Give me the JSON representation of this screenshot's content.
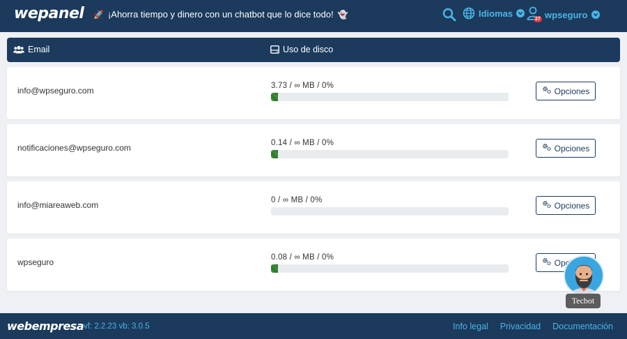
{
  "app": {
    "logo": "wepanel"
  },
  "header": {
    "promo_text": "¡Ahorra tiempo y dinero con un chatbot que lo dice todo!",
    "language_label": "Idiomas",
    "user_name": "wpseguro",
    "notification_count": "27",
    "accent_color": "#4ab4e6",
    "bar_color": "#1b3a5c"
  },
  "table": {
    "col_email": "Email",
    "col_disk": "Uso de disco",
    "rows": [
      {
        "email": "info@wpseguro.com",
        "usage": "3.73 / ∞ MB / 0%",
        "fill_percent": 3,
        "button": "Opciones"
      },
      {
        "email": "notificaciones@wpseguro.com",
        "usage": "0.14 / ∞ MB / 0%",
        "fill_percent": 3,
        "button": "Opciones"
      },
      {
        "email": "info@miareaweb.com",
        "usage": "0 / ∞ MB / 0%",
        "fill_percent": 0,
        "button": "Opciones"
      },
      {
        "email": "wpseguro",
        "usage": "0.08 / ∞ MB / 0%",
        "fill_percent": 3,
        "button": "Opciones"
      }
    ]
  },
  "chatbot": {
    "label": "Tecbot"
  },
  "footer": {
    "logo": "webempresa",
    "version": "vf: 2.2.23 vb: 3.0.5",
    "links": [
      "Info legal",
      "Privacidad",
      "Documentación"
    ]
  }
}
